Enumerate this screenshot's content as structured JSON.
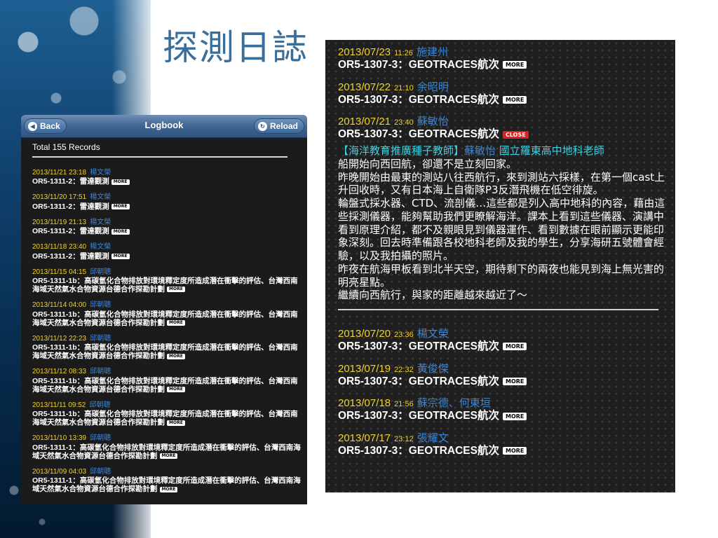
{
  "slide": {
    "title": "探測日誌"
  },
  "app": {
    "back_label": "Back",
    "title": "Logbook",
    "reload_label": "Reload",
    "total": "Total 155 Records",
    "items": [
      {
        "date": "2013/11/21 23:18",
        "author": "楊文榮",
        "title": "OR5-1311-2：雷達觀測",
        "more": "MORE"
      },
      {
        "date": "2013/11/20 17:51",
        "author": "楊文榮",
        "title": "OR5-1311-2：雷達觀測",
        "more": "MORE"
      },
      {
        "date": "2013/11/19 21:13",
        "author": "楊文榮",
        "title": "OR5-1311-2：雷達觀測",
        "more": "MORE"
      },
      {
        "date": "2013/11/18 23:40",
        "author": "楊文榮",
        "title": "OR5-1311-2：雷達觀測",
        "more": "MORE"
      },
      {
        "date": "2013/11/15 04:15",
        "author": "邱朝聰",
        "title": "OR5-1311-1b：高碳氫化合物排放對環境釋定度所造成潛在衝擊的評估、台灣西南海域天然氣水合物資源台德合作探勘計劃",
        "more": "MORE"
      },
      {
        "date": "2013/11/14 04:00",
        "author": "邱朝聰",
        "title": "OR5-1311-1b：高碳氫化合物排放對環境釋定度所造成潛在衝擊的評估、台灣西南海域天然氣水合物資源台德合作探勘計劃",
        "more": "MORE"
      },
      {
        "date": "2013/11/12 22:23",
        "author": "邱朝聰",
        "title": "OR5-1311-1b：高碳氫化合物排放對環境釋定度所造成潛在衝擊的評估、台灣西南海域天然氣水合物資源台德合作探勘計劃",
        "more": "MORE"
      },
      {
        "date": "2013/11/12 08:33",
        "author": "邱朝聰",
        "title": "OR5-1311-1b：高碳氫化合物排放對環境釋定度所造成潛在衝擊的評估、台灣西南海域天然氣水合物資源台德合作探勘計劃",
        "more": "MORE"
      },
      {
        "date": "2013/11/11 09:52",
        "author": "邱朝聰",
        "title": "OR5-1311-1b：高碳氫化合物排放對環境釋定度所造成潛在衝擊的評估、台灣西南海域天然氣水合物資源台德合作探勘計劃",
        "more": "MORE"
      },
      {
        "date": "2013/11/10 13:39",
        "author": "邱朝聰",
        "title": "OR5-1311-1：高碳氫化合物排放對環境釋定度所造成潛在衝擊的評估、台灣西南海域天然氣水合物資源台德合作探勘計劃",
        "more": "MORE"
      },
      {
        "date": "2013/11/09 04:03",
        "author": "邱朝聰",
        "title": "OR5-1311-1：高碳氫化合物排放對環境釋定度所造成潛在衝擊的評估、台灣西南海域天然氣水合物資源台德合作探勘計劃",
        "more": "MORE"
      }
    ]
  },
  "detail": {
    "entries_top": [
      {
        "date": "2013/07/23",
        "time": "11:26",
        "author": "施建州",
        "title": "OR5-1307-3：GEOTRACES航次",
        "badge": "MORE"
      },
      {
        "date": "2013/07/22",
        "time": "21:10",
        "author": "余昭明",
        "title": "OR5-1307-3：GEOTRACES航次",
        "badge": "MORE"
      }
    ],
    "open_entry": {
      "date": "2013/07/21",
      "time": "23:40",
      "author": "蘇敏怡",
      "title": "OR5-1307-3：GEOTRACES航次",
      "badge": "CLOSE",
      "head_prefix": "【海洋教育推廣種子教師】",
      "head_name": "蘇敏怡",
      "head_suffix": " 國立羅東高中地科老師",
      "paragraphs": [
        "船開始向西回航，卻還不是立刻回家。",
        "昨晚開始由最東的測站八往西航行，來到測站六採樣，在第一個cast上升回收時，又有日本海上自衛隊P3反潛飛機在低空徘旋。",
        "輪盤式採水器、CTD、流剖儀…這些都是列入高中地科的內容，藉由這些採測儀器，能夠幫助我們更瞭解海洋。課本上看到這些儀器、演講中看到原理介紹，都不及親眼見到儀器運作、看到數據在眼前顯示更能印象深刻。回去時準備跟各校地科老師及我的學生，分享海研五號體會經驗，以及我拍攝的照片。",
        "昨夜在航海甲板看到北半天空，期待剩下的兩夜也能見到海上無光害的明亮星點。",
        "繼續向西航行，與家的距離越來越近了～"
      ]
    },
    "entries_bottom": [
      {
        "date": "2013/07/20",
        "time": "23:36",
        "author": "楊文榮",
        "title": "OR5-1307-3：GEOTRACES航次",
        "badge": "MORE"
      },
      {
        "date": "2013/07/19",
        "time": "22:32",
        "author": "黃俊傑",
        "title": "OR5-1307-3：GEOTRACES航次",
        "badge": "MORE"
      },
      {
        "date": "2013/07/18",
        "time": "21:56",
        "author": "蘇宗德、何東垣",
        "title": "OR5-1307-3：GEOTRACES航次",
        "badge": "MORE"
      },
      {
        "date": "2013/07/17",
        "time": "23:12",
        "author": "張耀文",
        "title": "OR5-1307-3：GEOTRACES航次",
        "badge": "MORE"
      }
    ]
  },
  "colors": {
    "date_yellow": "#f2d22a",
    "author_blue": "#3a86d6",
    "heading_cyan": "#3fd0e0",
    "close_red": "#e02020",
    "header_blue": "#3f6591"
  },
  "icons": {
    "back": "back-arrow-icon",
    "reload": "reload-icon"
  }
}
